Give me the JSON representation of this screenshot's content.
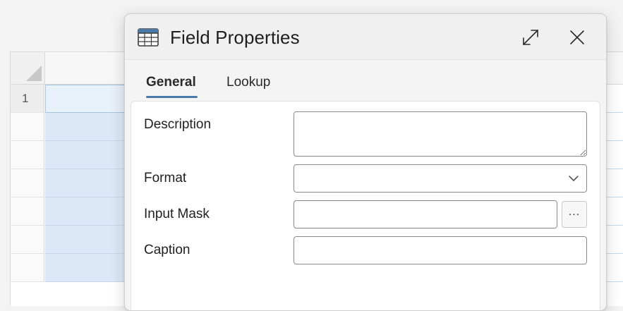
{
  "sheet": {
    "rows": [
      "1",
      "",
      "",
      "",
      "",
      "",
      ""
    ]
  },
  "dialog": {
    "title": "Field Properties",
    "icon": "table-icon",
    "expand_icon": "expand-icon",
    "close_icon": "close-icon",
    "tabs": [
      {
        "label": "General",
        "active": true
      },
      {
        "label": "Lookup",
        "active": false
      }
    ],
    "accent_color": "#4a78a8",
    "properties": {
      "description": {
        "label": "Description",
        "value": ""
      },
      "format": {
        "label": "Format",
        "value": ""
      },
      "input_mask": {
        "label": "Input Mask",
        "value": "",
        "builder_label": "..."
      },
      "caption": {
        "label": "Caption",
        "value": ""
      }
    }
  }
}
